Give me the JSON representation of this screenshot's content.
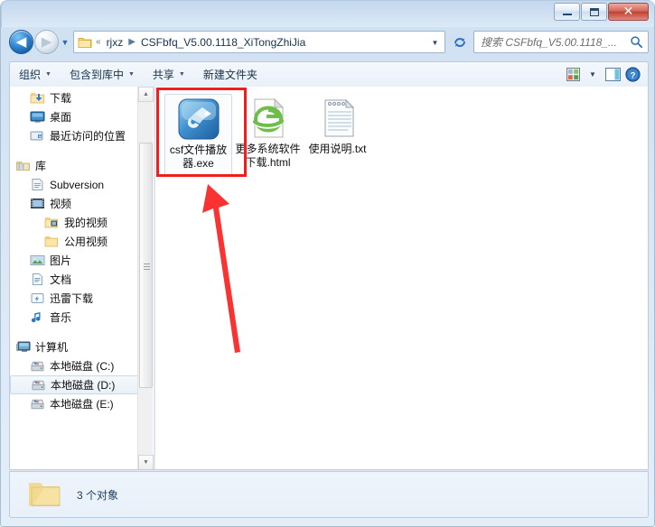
{
  "window": {
    "controls": {
      "minimize_label": "最小化",
      "maximize_label": "最大化",
      "close_label": "✕"
    }
  },
  "address_bar": {
    "back_label": "◀",
    "forward_label": "▶",
    "recent_label": "▼",
    "breadcrumb": {
      "prefix": "«",
      "items": [
        "rjxz",
        "CSFbfq_V5.00.1118_XiTongZhiJia"
      ],
      "separator": "▶"
    },
    "dropdown_label": "▼",
    "refresh_label": "refresh-icon",
    "search_placeholder": "搜索 CSFbfq_V5.00.1118_..."
  },
  "toolbar": {
    "items": [
      {
        "label": "组织",
        "caret": "▼"
      },
      {
        "label": "包含到库中",
        "caret": "▼"
      },
      {
        "label": "共享",
        "caret": "▼"
      },
      {
        "label": "新建文件夹",
        "caret": ""
      }
    ],
    "view_caret": "▼"
  },
  "nav_pane": {
    "items": [
      {
        "label": "下载",
        "icon": "download-folder-icon",
        "indent": 1,
        "selected": false
      },
      {
        "label": "桌面",
        "icon": "desktop-icon",
        "indent": 1,
        "selected": false
      },
      {
        "label": "最近访问的位置",
        "icon": "recent-places-icon",
        "indent": 1,
        "selected": false
      },
      {
        "label": "",
        "icon": "gap",
        "indent": 0,
        "selected": false
      },
      {
        "label": "库",
        "icon": "library-icon",
        "indent": 0,
        "selected": false
      },
      {
        "label": "Subversion",
        "icon": "subversion-icon",
        "indent": 1,
        "selected": false
      },
      {
        "label": "视频",
        "icon": "video-icon",
        "indent": 1,
        "selected": false
      },
      {
        "label": "我的视频",
        "icon": "my-video-folder-icon",
        "indent": 2,
        "selected": false
      },
      {
        "label": "公用视频",
        "icon": "public-video-folder-icon",
        "indent": 2,
        "selected": false
      },
      {
        "label": "图片",
        "icon": "pictures-icon",
        "indent": 1,
        "selected": false
      },
      {
        "label": "文档",
        "icon": "documents-icon",
        "indent": 1,
        "selected": false
      },
      {
        "label": "迅雷下载",
        "icon": "thunder-download-icon",
        "indent": 1,
        "selected": false
      },
      {
        "label": "音乐",
        "icon": "music-icon",
        "indent": 1,
        "selected": false
      },
      {
        "label": "",
        "icon": "gap",
        "indent": 0,
        "selected": false
      },
      {
        "label": "计算机",
        "icon": "computer-icon",
        "indent": 0,
        "selected": false
      },
      {
        "label": "本地磁盘 (C:)",
        "icon": "drive-icon",
        "indent": 1,
        "selected": false
      },
      {
        "label": "本地磁盘 (D:)",
        "icon": "drive-icon",
        "indent": 1,
        "selected": true
      },
      {
        "label": "本地磁盘 (E:)",
        "icon": "drive-icon",
        "indent": 1,
        "selected": false
      }
    ],
    "scroll_up_label": "▲",
    "scroll_down_label": "▼"
  },
  "files": [
    {
      "name": "csf文件播放器.exe",
      "icon": "csf-player-app-icon",
      "selected": true
    },
    {
      "name": "更多系统软件下载.html",
      "icon": "ie-html-file-icon",
      "selected": false
    },
    {
      "name": "使用说明.txt",
      "icon": "text-file-icon",
      "selected": false
    }
  ],
  "status_bar": {
    "text": "3 个对象",
    "folder_icon": "folder-icon"
  },
  "annotations": {
    "highlight_color": "#f41c1c",
    "arrow_color": "#fa3232"
  }
}
